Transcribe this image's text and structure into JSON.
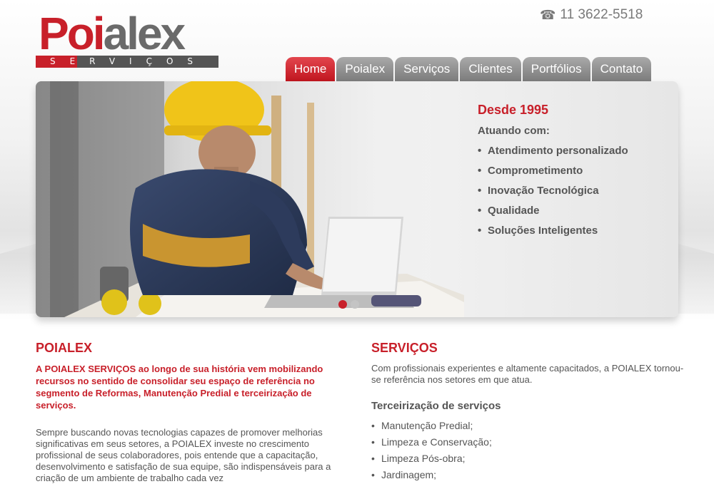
{
  "logo": {
    "brand_part1": "Poi",
    "brand_part2": "alex",
    "tagline": "SERVIÇOS"
  },
  "phone": {
    "icon": "phone-icon",
    "number": "11 3622-5518"
  },
  "nav": [
    "Home",
    "Poialex",
    "Serviços",
    "Clientes",
    "Portfólios",
    "Contato"
  ],
  "hero": {
    "since": "Desde 1995",
    "acting": "Atuando com:",
    "items": [
      "Atendimento personalizado",
      "Comprometimento",
      "Inovação Tecnológica",
      "Qualidade",
      "Soluções Inteligentes"
    ],
    "active_slide": 1,
    "slides": 2
  },
  "about": {
    "title": "POIALEX",
    "lead": "A POIALEX SERVIÇOS ao longo de sua história vem mobilizando recursos no sentido de consolidar seu espaço de referência no segmento de Reformas, Manutenção Predial e terceirização de serviços.",
    "body": "Sempre buscando novas tecnologias capazes de promover melhorias significativas em seus setores, a POIALEX investe no crescimento profissional de seus colaboradores, pois entende que a capacitação, desenvolvimento e satisfação de sua equipe, são indispensáveis para a criação de um ambiente de trabalho cada vez"
  },
  "services": {
    "title": "SERVIÇOS",
    "intro": "Com profissionais experientes e altamente capacitados, a POIALEX tornou-se referência nos setores em que atua.",
    "subtitle": "Terceirização de serviços",
    "items": [
      "Manutenção Predial;",
      "Limpeza e Conservação;",
      "Limpeza Pós-obra;",
      "Jardinagem;"
    ]
  },
  "colors": {
    "accent": "#c8202a",
    "text": "#555555",
    "tab": "#8a8a8a"
  }
}
